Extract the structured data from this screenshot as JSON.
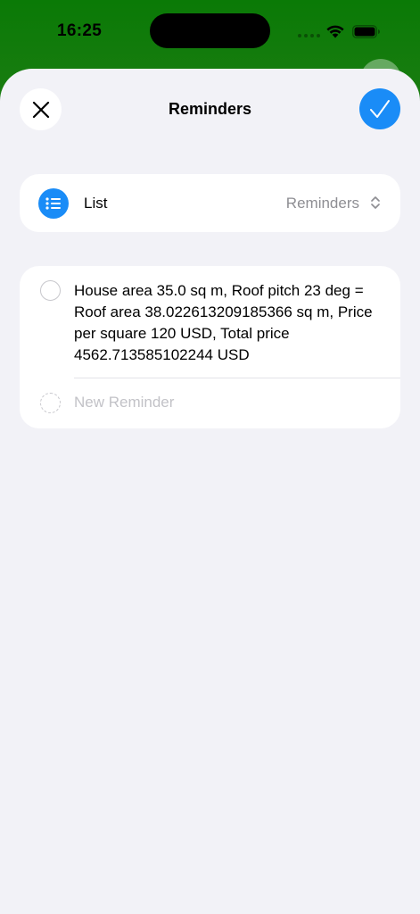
{
  "status_bar": {
    "time": "16:25"
  },
  "header": {
    "title": "Reminders",
    "close_icon": "close-icon",
    "done_icon": "checkmark-icon",
    "accent_color": "#1a8cf7"
  },
  "list_row": {
    "label": "List",
    "value": "Reminders",
    "icon": "list-bullet-icon"
  },
  "reminders": {
    "items": [
      {
        "text": "House area 35.0 sq m, Roof pitch 23 deg = Roof area 38.022613209185366 sq m, Price per square 120 USD, Total price 4562.713585102244 USD"
      }
    ],
    "new_placeholder": "New Reminder"
  }
}
